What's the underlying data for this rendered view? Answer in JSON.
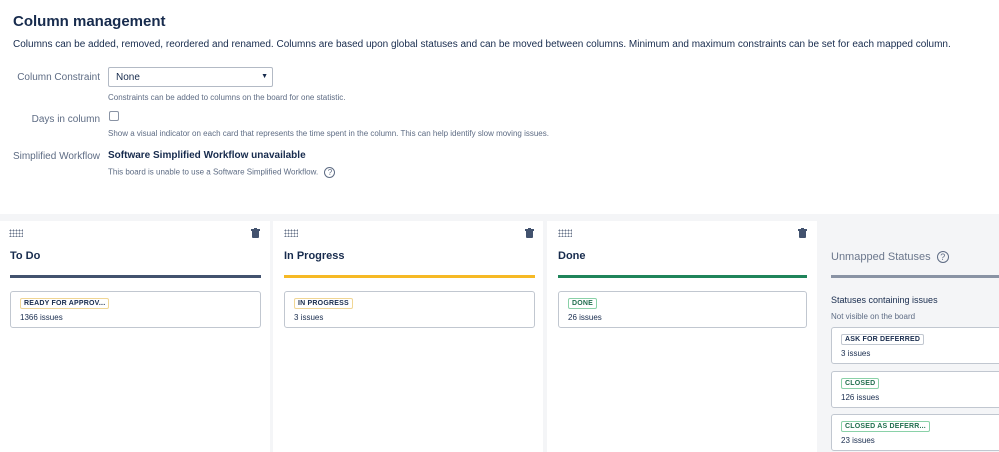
{
  "header": {
    "title": "Column management",
    "description": "Columns can be added, removed, reordered and renamed. Columns are based upon global statuses and can be moved between columns. Minimum and maximum constraints can be set for each mapped column."
  },
  "form": {
    "constraint_label": "Column Constraint",
    "constraint_value": "None",
    "constraint_help": "Constraints can be added to columns on the board for one statistic.",
    "days_label": "Days in column",
    "days_checked": false,
    "days_help": "Show a visual indicator on each card that represents the time spent in the column. This can help identify slow moving issues.",
    "workflow_label": "Simplified Workflow",
    "workflow_value": "Software Simplified Workflow unavailable",
    "workflow_help": "This board is unable to use a Software Simplified Workflow."
  },
  "columns": [
    {
      "title": "To Do",
      "bar_color": "#42526e",
      "status": "READY FOR APPROV...",
      "count": "1366 issues",
      "lozenge_style": "yellow"
    },
    {
      "title": "In Progress",
      "bar_color": "#f6b925",
      "status": "IN PROGRESS",
      "count": "3 issues",
      "lozenge_style": "yellow"
    },
    {
      "title": "Done",
      "bar_color": "#1f845a",
      "status": "DONE",
      "count": "26 issues",
      "lozenge_style": "green"
    }
  ],
  "unmapped": {
    "title": "Unmapped Statuses",
    "subtitle": "Statuses containing issues",
    "note": "Not visible on the board",
    "statuses": [
      {
        "status": "ASK FOR DEFERRED",
        "count": "3 issues",
        "lozenge_style": "gray"
      },
      {
        "status": "CLOSED",
        "count": "126 issues",
        "lozenge_style": "green"
      },
      {
        "status": "CLOSED AS DEFERR...",
        "count": "23 issues",
        "lozenge_style": "green"
      }
    ]
  },
  "icons": {
    "drag": "drag-handle-icon",
    "delete": "trash-icon",
    "help": "help-icon",
    "dropdown": "chevron-down-icon"
  },
  "colors": {
    "lozenge_yellow_border": "#f0d695",
    "lozenge_yellow_text": "#172b4d",
    "lozenge_green_border": "#8ad1a8",
    "lozenge_green_text": "#216e4e",
    "lozenge_gray_border": "#c1c7d0",
    "lozenge_gray_text": "#172b4d"
  }
}
